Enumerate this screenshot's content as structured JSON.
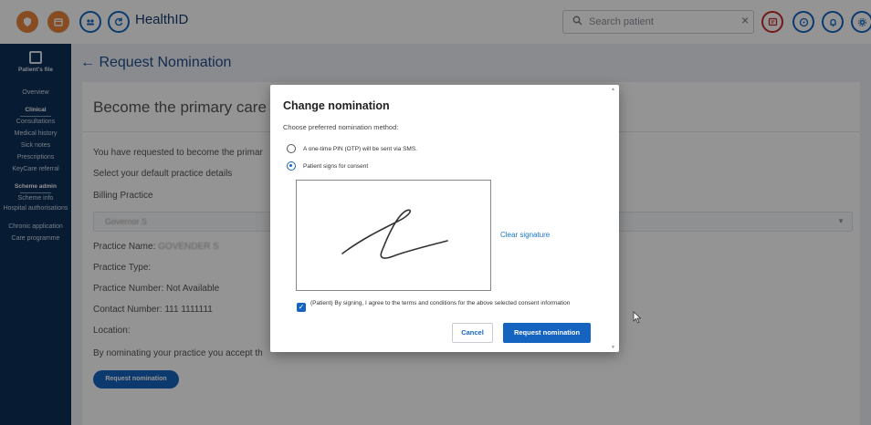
{
  "header": {
    "app_title": "HealthID",
    "search_placeholder": "Search patient",
    "search_clear": "×",
    "icons": [
      "shield-logo-icon",
      "calendar-icon",
      "group-icon",
      "refresh-icon",
      "chat-icon",
      "help-icon",
      "bell-icon",
      "settings-icon"
    ]
  },
  "sidebar": {
    "patient_file": "Patient's file",
    "overview": "Overview",
    "clinical_head": "Clinical",
    "consultations": "Consultations",
    "medical_history": "Medical history",
    "sick_notes": "Sick notes",
    "prescriptions": "Prescriptions",
    "keycare_referral": "KeyCare referral",
    "scheme_admin_head": "Scheme admin",
    "scheme_info": "Scheme info",
    "hospital_auth": "Hospital authorisations",
    "chronic_application": "Chronic application",
    "care_programme": "Care programme"
  },
  "page": {
    "back_arrow": "←",
    "title": "Request Nomination",
    "card_heading": "Become the primary care do",
    "requested_line": "You have requested to become the primar",
    "select_default": "Select your default practice details",
    "billing_label": "Billing Practice",
    "billing_value": "Governor S",
    "practice_name_label": "Practice Name:",
    "practice_name_value": "GOVENDER S",
    "practice_type": "Practice Type:",
    "practice_number": "Practice Number: Not Available",
    "contact_number": "Contact Number: 111 1111111",
    "location": "Location:",
    "accept_line": "By nominating your practice you accept th",
    "request_button": "Request nomination"
  },
  "modal": {
    "title": "Change nomination",
    "subtitle": "Choose preferred nomination method:",
    "option_otp": "A one-time PIN (OTP) will be sent via SMS.",
    "option_sign": "Patient signs for consent",
    "selected_option": "Patient signs for consent",
    "clear_signature": "Clear signature",
    "consent_text": "(Patient) By signing, I agree to the terms and conditions for the above selected consent information",
    "consent_checked": true,
    "cancel": "Cancel",
    "request": "Request nomination"
  },
  "colors": {
    "primary": "#1565c0",
    "sidebar": "#0d2f57",
    "title_blue": "#1f4e8c"
  }
}
